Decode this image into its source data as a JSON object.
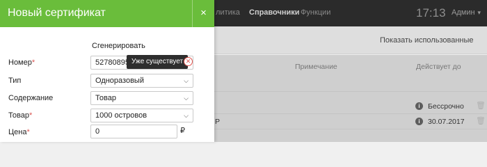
{
  "nav": {
    "items": [
      "литика",
      "Справочники",
      "Функции"
    ],
    "clock": "17:13",
    "user": "Админ"
  },
  "toolbar": {
    "used_button": "Показать использованные"
  },
  "table": {
    "headers": {
      "note": "Примечание",
      "valid_until": "Действует до"
    },
    "rows": [
      {
        "prefix": "",
        "valid_until": "Бессрочно"
      },
      {
        "prefix": "Р",
        "valid_until": "30.07.2017"
      }
    ]
  },
  "panel": {
    "title": "Новый сертификат",
    "close_glyph": "×",
    "generate_label": "Сгенерировать",
    "fields": {
      "number": {
        "label": "Номер",
        "required": true,
        "value": "527808955",
        "error_tooltip": "Уже существует"
      },
      "type": {
        "label": "Тип",
        "value": "Одноразовый"
      },
      "content": {
        "label": "Содержание",
        "value": "Товар"
      },
      "product": {
        "label": "Товар",
        "required": true,
        "value": "1000 островов"
      },
      "price": {
        "label": "Цена",
        "required": true,
        "value": "0",
        "currency": "₽"
      }
    },
    "required_mark": "*"
  },
  "colors": {
    "panel_header": "#6abd3b",
    "error": "#e0534e",
    "topbar": "#2b2b2b"
  },
  "icons": [
    "close-icon",
    "chevron-down-icon",
    "error-circle-icon",
    "info-icon",
    "trash-icon"
  ]
}
